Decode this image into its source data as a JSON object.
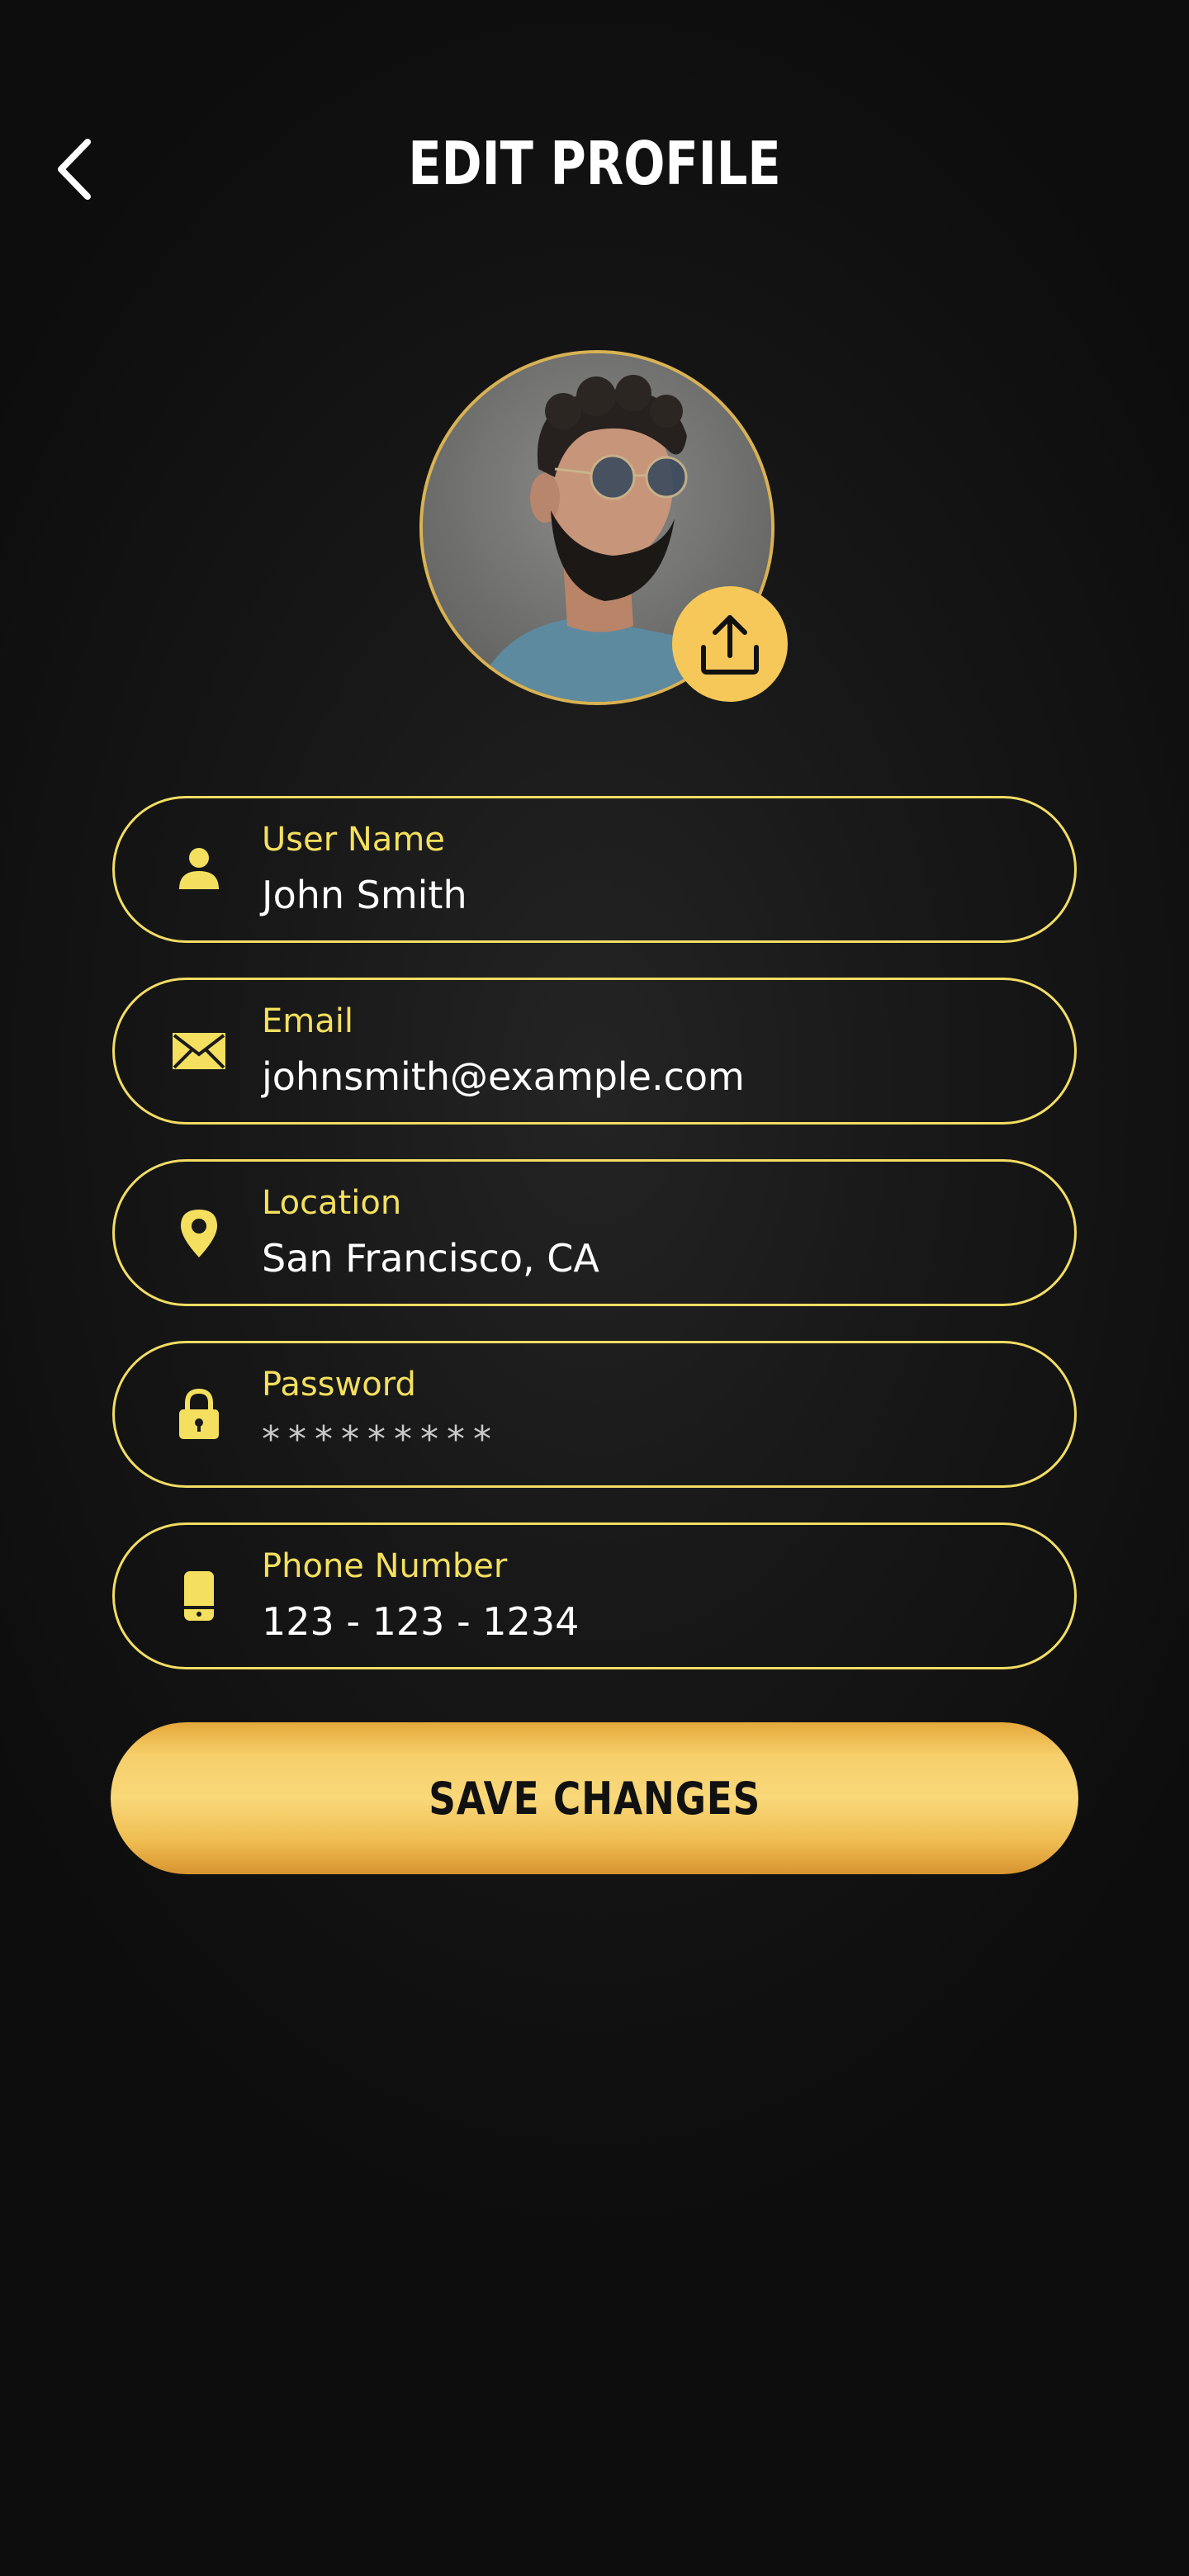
{
  "header": {
    "title": "EDIT PROFILE",
    "back_icon": "chevron-left-icon"
  },
  "avatar": {
    "upload_icon": "upload-icon"
  },
  "fields": [
    {
      "label": "User Name",
      "value": "John Smith",
      "icon": "user-icon"
    },
    {
      "label": "Email",
      "value": "johnsmith@example.com",
      "icon": "envelope-icon"
    },
    {
      "label": "Location",
      "value": "San Francisco, CA",
      "icon": "map-pin-icon"
    },
    {
      "label": "Password",
      "value": "*********",
      "icon": "lock-icon"
    },
    {
      "label": "Phone Number",
      "value": "123 - 123 - 1234",
      "icon": "phone-icon"
    }
  ],
  "actions": {
    "save_label": "SAVE CHANGES"
  },
  "colors": {
    "accent": "#F4E05E",
    "button_gold": "#F6C85A",
    "background": "#121212",
    "text": "#FFFFFF"
  }
}
